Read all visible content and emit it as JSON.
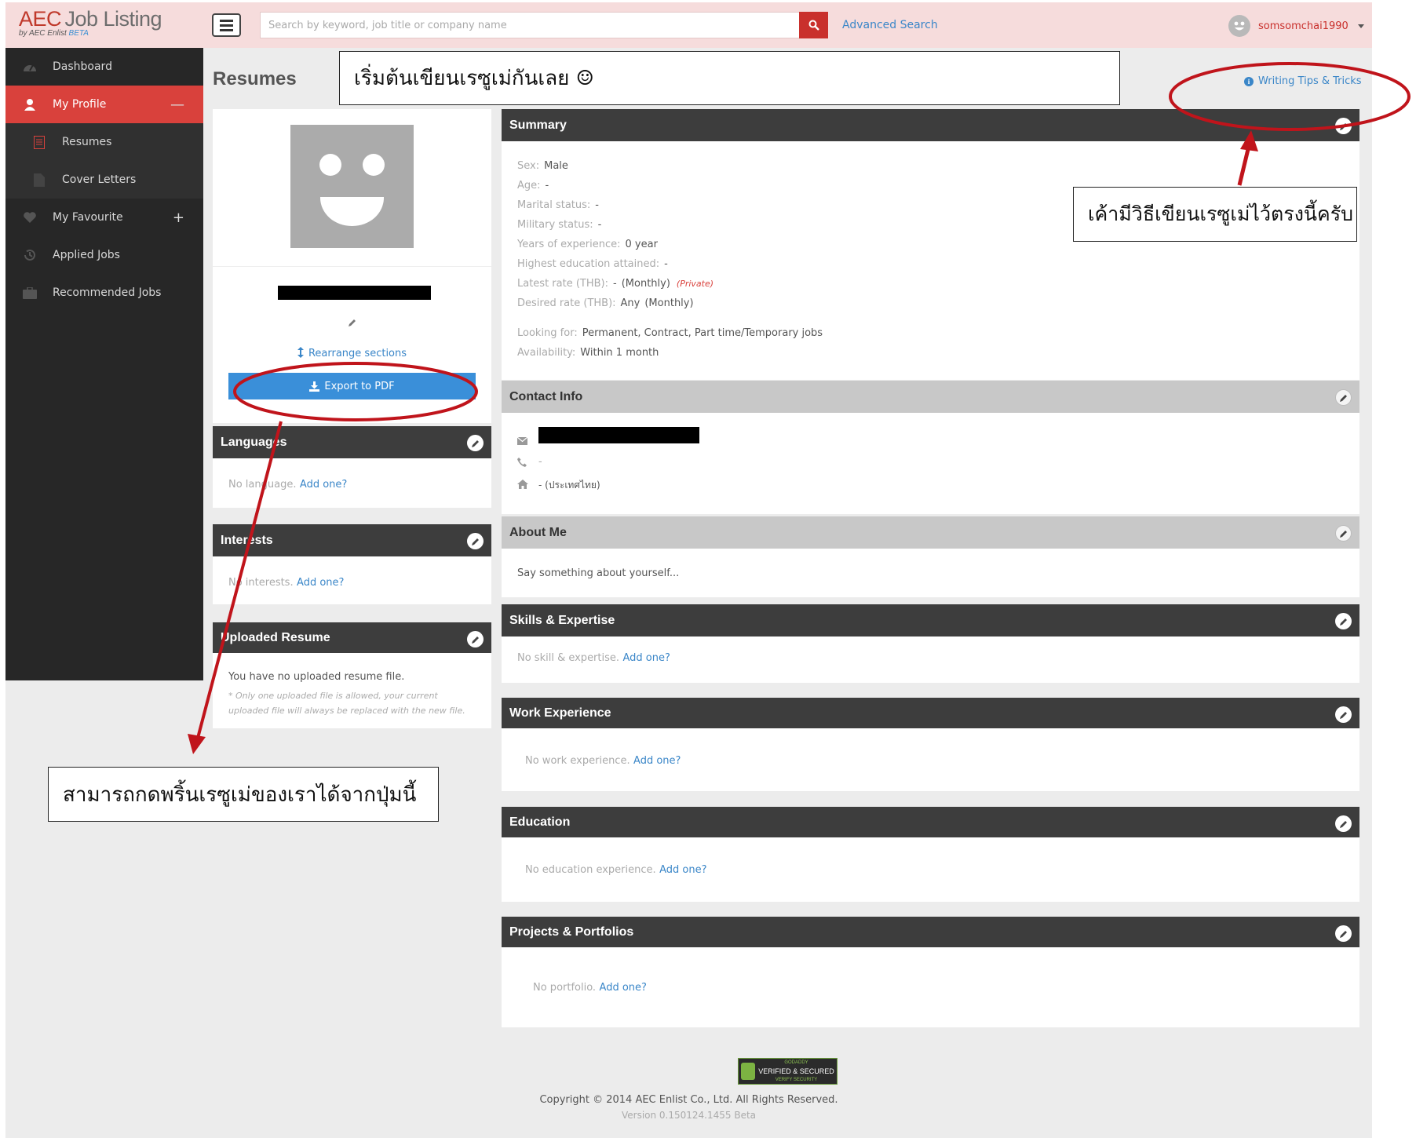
{
  "brand": {
    "part1": "AEC",
    "part2": "Job Listing",
    "byline": "by AEC Enlist",
    "beta": "BETA"
  },
  "search": {
    "placeholder": "Search by keyword, job title or company name"
  },
  "header": {
    "advanced_search": "Advanced Search",
    "username": "somsomchai1990"
  },
  "sidebar": {
    "items": [
      {
        "label": "Dashboard"
      },
      {
        "label": "My Profile",
        "toggle": "—"
      },
      {
        "label": "Resumes"
      },
      {
        "label": "Cover Letters"
      },
      {
        "label": "My Favourite",
        "toggle": "+"
      },
      {
        "label": "Applied Jobs"
      },
      {
        "label": "Recommended Jobs"
      }
    ]
  },
  "page": {
    "title": "Resumes",
    "tips": "Writing Tips & Tricks"
  },
  "profile": {
    "rearrange": "Rearrange sections",
    "export": "Export to PDF"
  },
  "languages": {
    "title": "Languages",
    "empty": "No language.",
    "add": "Add one?"
  },
  "interests": {
    "title": "Interests",
    "empty": "No interests.",
    "add": "Add one?"
  },
  "uploaded": {
    "title": "Uploaded Resume",
    "text": "You have no uploaded resume file.",
    "note1": "* Only one uploaded file is allowed, your current",
    "note2": "uploaded file will always be replaced with the new file."
  },
  "summary": {
    "title": "Summary",
    "sex_label": "Sex:",
    "sex": "Male",
    "age_label": "Age:",
    "age": "-",
    "marital_label": "Marital status:",
    "marital": "-",
    "military_label": "Military status:",
    "military": "-",
    "exp_label": "Years of experience:",
    "exp": "0 year",
    "edu_label": "Highest education attained:",
    "edu": "-",
    "latest_label": "Latest rate (THB):",
    "latest": "-",
    "latest_unit": "(Monthly)",
    "latest_private": "(Private)",
    "desired_label": "Desired rate (THB):",
    "desired": "Any",
    "desired_unit": "(Monthly)",
    "looking_label": "Looking for:",
    "looking": "Permanent, Contract, Part time/Temporary jobs",
    "avail_label": "Availability:",
    "avail": "Within 1 month"
  },
  "contact": {
    "title": "Contact Info",
    "phone": "-",
    "address": "- (ประเทศไทย)"
  },
  "about": {
    "title": "About Me",
    "text": "Say something about yourself..."
  },
  "skills": {
    "title": "Skills & Expertise",
    "empty": "No skill & expertise.",
    "add": "Add one?"
  },
  "work": {
    "title": "Work Experience",
    "empty": "No work experience.",
    "add": "Add one?"
  },
  "education": {
    "title": "Education",
    "empty": "No education experience.",
    "add": "Add one?"
  },
  "projects": {
    "title": "Projects & Portfolios",
    "empty": "No portfolio.",
    "add": "Add one?"
  },
  "footer": {
    "badge_top": "GODADDY",
    "badge": "VERIFIED & SECURED",
    "badge_bottom": "VERIFY SECURITY",
    "copyright": "Copyright © 2014 AEC Enlist Co., Ltd. All Rights Reserved.",
    "version": "Version 0.150124.1455 Beta"
  },
  "annotations": {
    "top": "เริ่มต้นเขียนเรซูเม่กันเลย ☺",
    "right": "เค้ามีวิธีเขียนเรซูเม่ไว้ตรงนี้ครับ",
    "left": "สามารถกดพริ้นเรซูเม่ของเราได้จากปุ่มนี้"
  },
  "colors": {
    "accent": "#d9413c",
    "sidebar": "#272727",
    "link": "#3a86c8",
    "export": "#3a8fd9",
    "annotation_red": "#c0141b",
    "header_bg": "#f6dcdc"
  },
  "icons": [
    "menu-icon",
    "search-icon",
    "user-face-icon",
    "caret-down-icon",
    "dashboard-icon",
    "user-icon",
    "document-icon",
    "file-icon",
    "heart-icon",
    "history-icon",
    "briefcase-icon",
    "info-icon",
    "pencil-icon",
    "envelope-icon",
    "phone-icon",
    "home-icon",
    "download-icon",
    "sort-icon",
    "shield-icon"
  ]
}
